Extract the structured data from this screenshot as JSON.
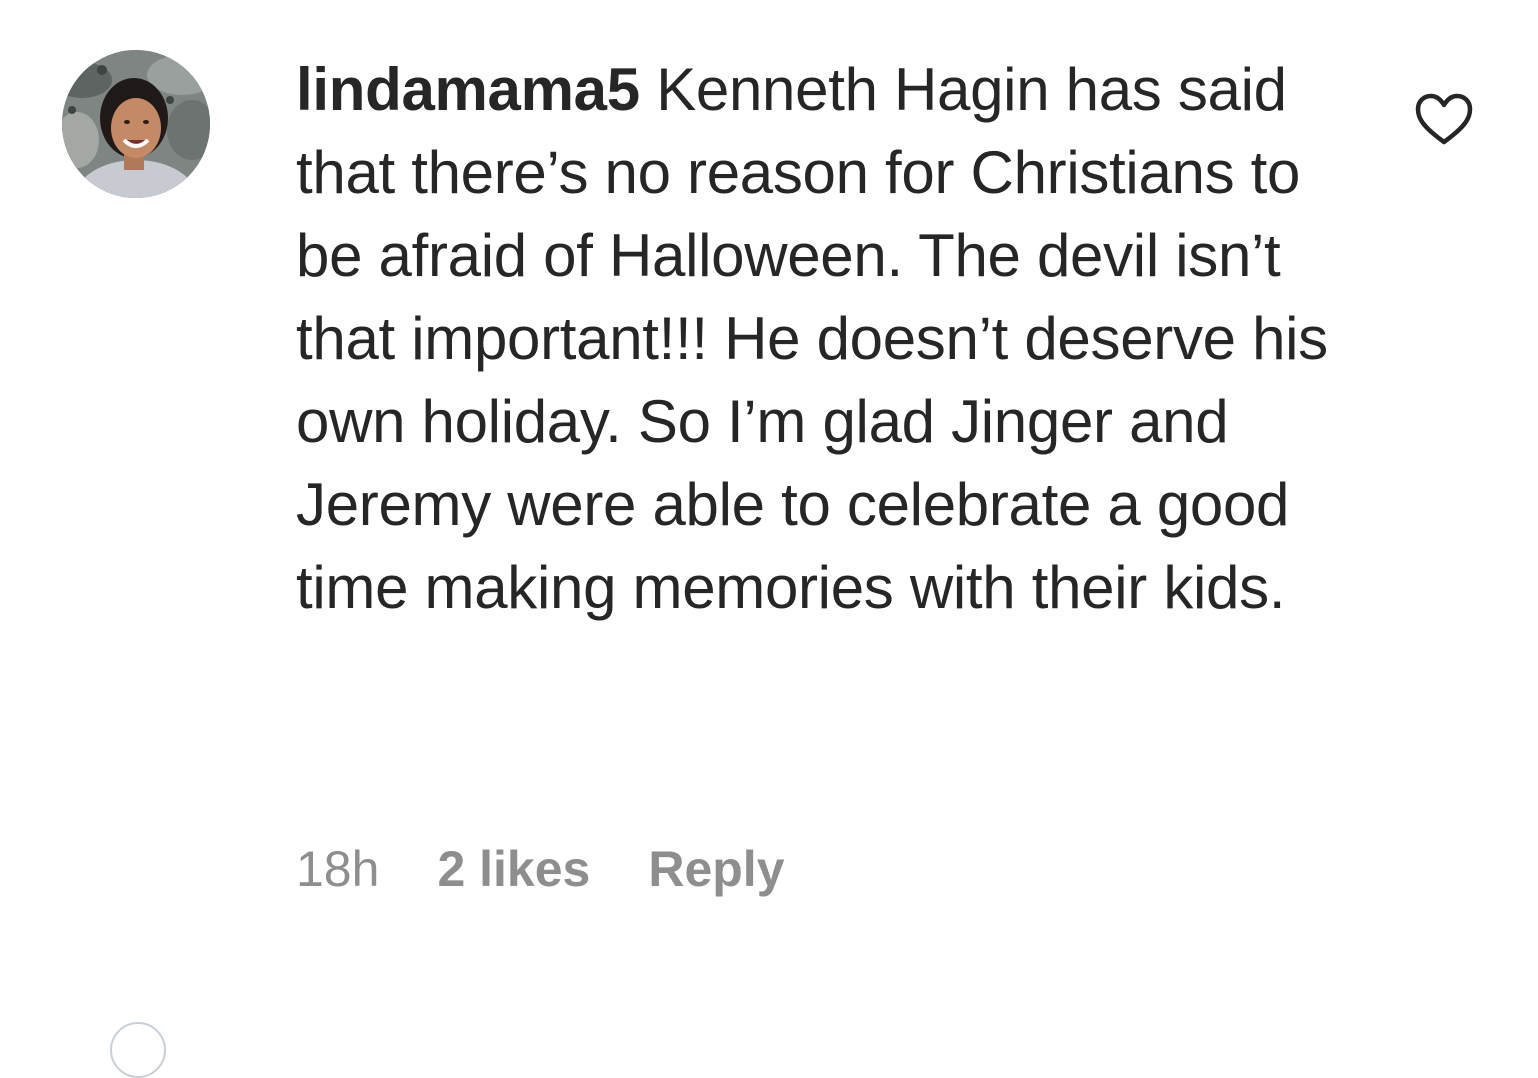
{
  "comment": {
    "username": "lindamama5",
    "text": "Kenneth Hagin has said that there’s no reason for Christians to be afraid of Halloween. The devil isn’t that important!!! He doesn’t deserve his own holiday. So I’m glad Jinger and Jeremy were able to celebrate a good time making memories with their kids.",
    "timestamp": "18h",
    "likes": "2 likes",
    "reply_label": "Reply",
    "avatar_icon": "user-avatar-photo",
    "like_icon": "heart-outline-icon"
  },
  "colors": {
    "text": "#262626",
    "meta": "#8e8e8e",
    "background": "#ffffff"
  }
}
